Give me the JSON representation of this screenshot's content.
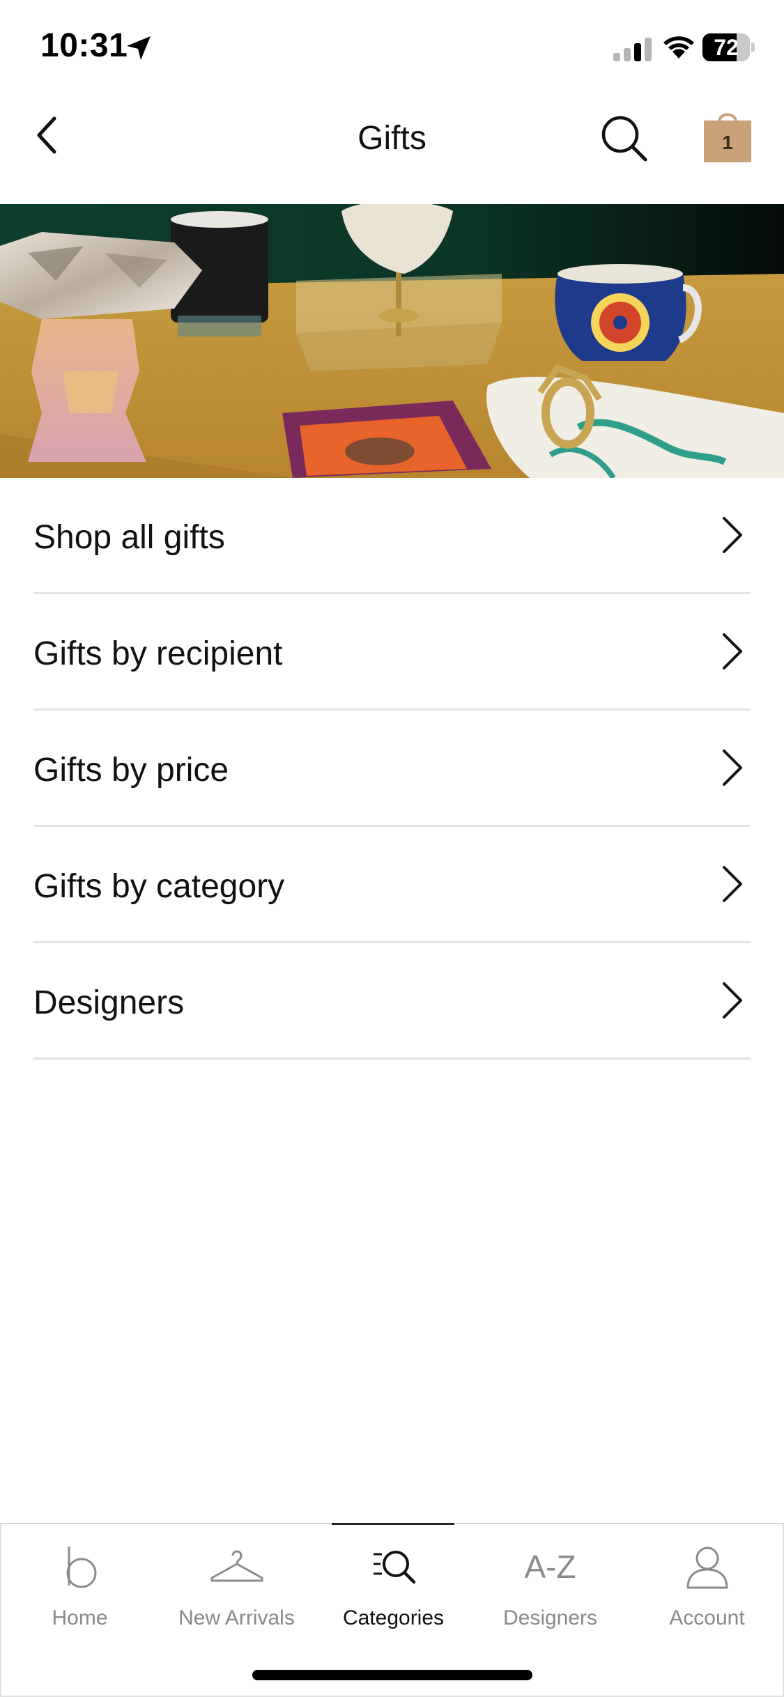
{
  "status_bar": {
    "time": "10:31",
    "battery_percent": 72,
    "battery_label": "72"
  },
  "header": {
    "title": "Gifts",
    "bag_count": "1",
    "bag_color": "#c9a27a"
  },
  "menu": {
    "items": [
      {
        "label": "Shop all gifts"
      },
      {
        "label": "Gifts by recipient"
      },
      {
        "label": "Gifts by price"
      },
      {
        "label": "Gifts by category"
      },
      {
        "label": "Designers"
      }
    ]
  },
  "tab_bar": {
    "active_index": 2,
    "tabs": [
      {
        "label": "Home",
        "icon": "brand-b-icon"
      },
      {
        "label": "New Arrivals",
        "icon": "hanger-icon"
      },
      {
        "label": "Categories",
        "icon": "categories-search-icon"
      },
      {
        "label": "Designers",
        "icon": "a-z-icon",
        "icon_text": "A-Z"
      },
      {
        "label": "Account",
        "icon": "person-icon"
      }
    ]
  }
}
